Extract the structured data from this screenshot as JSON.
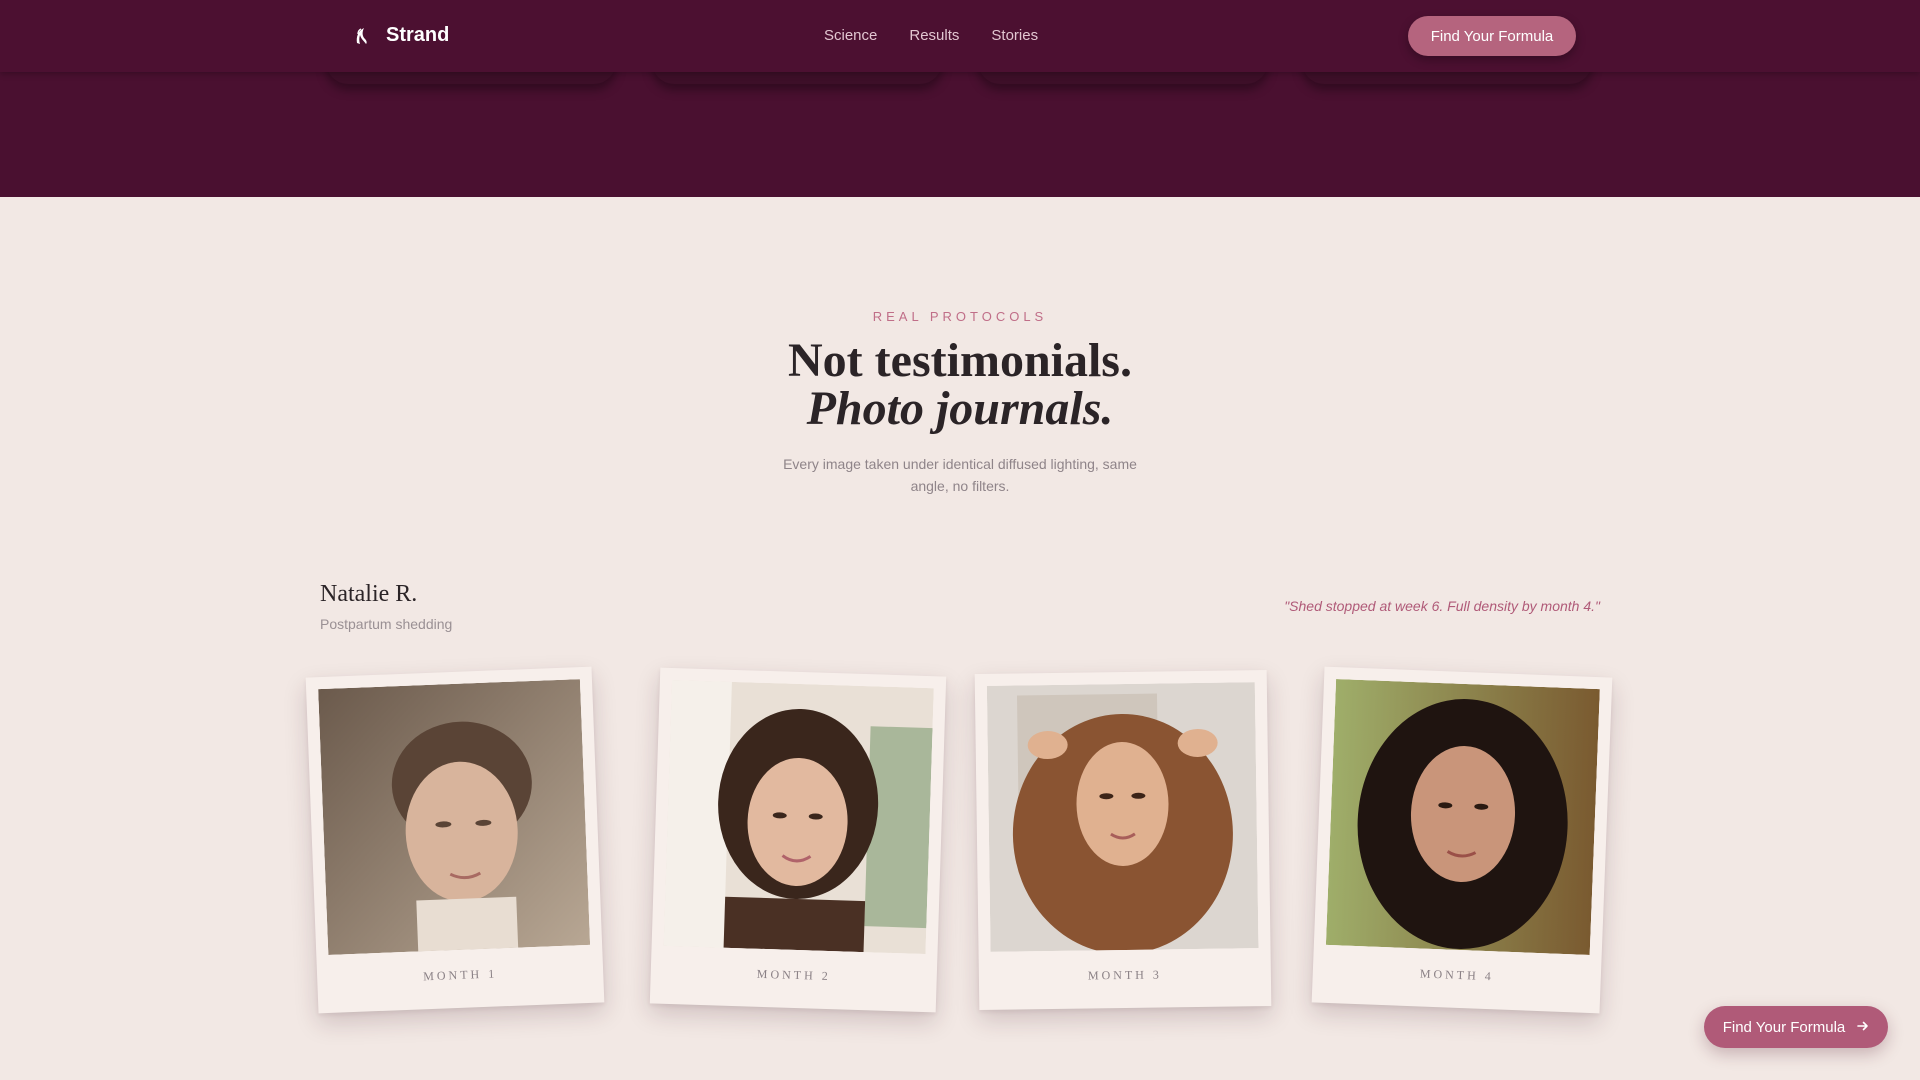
{
  "nav": {
    "brand": "Strand",
    "links": [
      "Science",
      "Results",
      "Stories"
    ],
    "cta_label": "Find Your Formula"
  },
  "section": {
    "eyebrow": "REAL PROTOCOLS",
    "headline_line1": "Not testimonials.",
    "headline_line2": "Photo journals.",
    "subtext": "Every image taken under identical diffused lighting, same angle, no filters."
  },
  "person": {
    "name": "Natalie R.",
    "condition": "Postpartum shedding",
    "quote": "\"Shed stopped at week 6. Full density by month 4.\""
  },
  "journal": [
    {
      "label": "MONTH 1",
      "photo": "portrait-month-1"
    },
    {
      "label": "MONTH 2",
      "photo": "portrait-month-2"
    },
    {
      "label": "MONTH 3",
      "photo": "portrait-month-3"
    },
    {
      "label": "MONTH 4",
      "photo": "portrait-month-4"
    }
  ],
  "floating_cta": {
    "label": "Find Your Formula",
    "icon": "arrow-right-icon"
  },
  "colors": {
    "brand_dark": "#4a1030",
    "accent": "#b5647e",
    "background": "#f2e8e4",
    "text": "#2b2427"
  }
}
